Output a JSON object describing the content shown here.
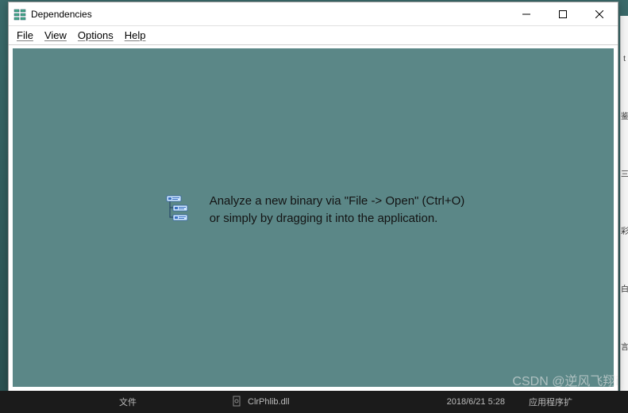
{
  "window": {
    "title": "Dependencies"
  },
  "menu": {
    "file": "File",
    "view": "View",
    "options": "Options",
    "help": "Help"
  },
  "empty": {
    "line1": "Analyze a new binary via \"File -> Open\" (Ctrl+O)",
    "line2": "or simply by dragging it into the application."
  },
  "taskbar": {
    "label1": "文件",
    "file": "ClrPhlib.dll",
    "time": "2018/6/21 5:28",
    "type": "应用程序扩"
  },
  "watermark": "CSDN @逆风飞翔i"
}
